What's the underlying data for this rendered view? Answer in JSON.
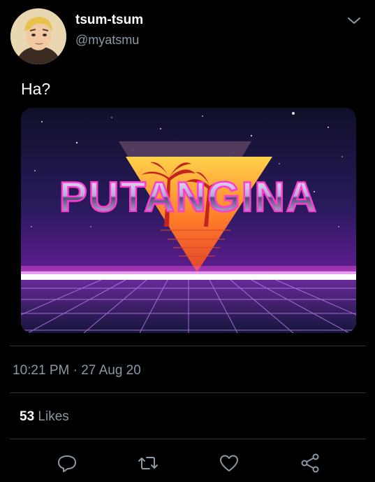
{
  "tweet": {
    "author": {
      "display_name": "tsum-tsum",
      "handle": "@myatsmu",
      "avatar_icon": "avatar-anime-character"
    },
    "text": "Ha?",
    "media": {
      "overlay_text": "PUTANGINA"
    },
    "timestamp": "10:21 PM · 27 Aug 20",
    "stats": {
      "likes_count": "53",
      "likes_label": "Likes"
    },
    "actions": [
      "reply-icon",
      "retweet-icon",
      "like-icon",
      "share-icon"
    ]
  },
  "colors": {
    "background": "#000000",
    "secondary_text": "#8b98a5",
    "divider": "#2f3336"
  }
}
